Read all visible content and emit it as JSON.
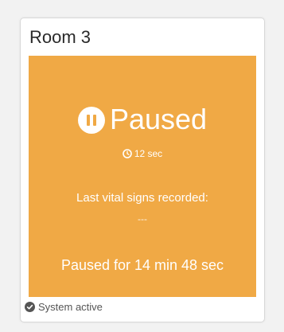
{
  "room": {
    "title": "Room 3"
  },
  "monitor": {
    "state_label": "Paused",
    "state_icon": "pause-circle-icon",
    "timer_text": "12 sec",
    "timer_icon": "clock-icon",
    "vitals_label": "Last vital signs recorded:",
    "vitals_value": "---",
    "paused_duration": "Paused for 14 min 48 sec",
    "panel_color": "#f0a945"
  },
  "footer": {
    "status_icon": "check-circle-icon",
    "status_text": "System active"
  }
}
